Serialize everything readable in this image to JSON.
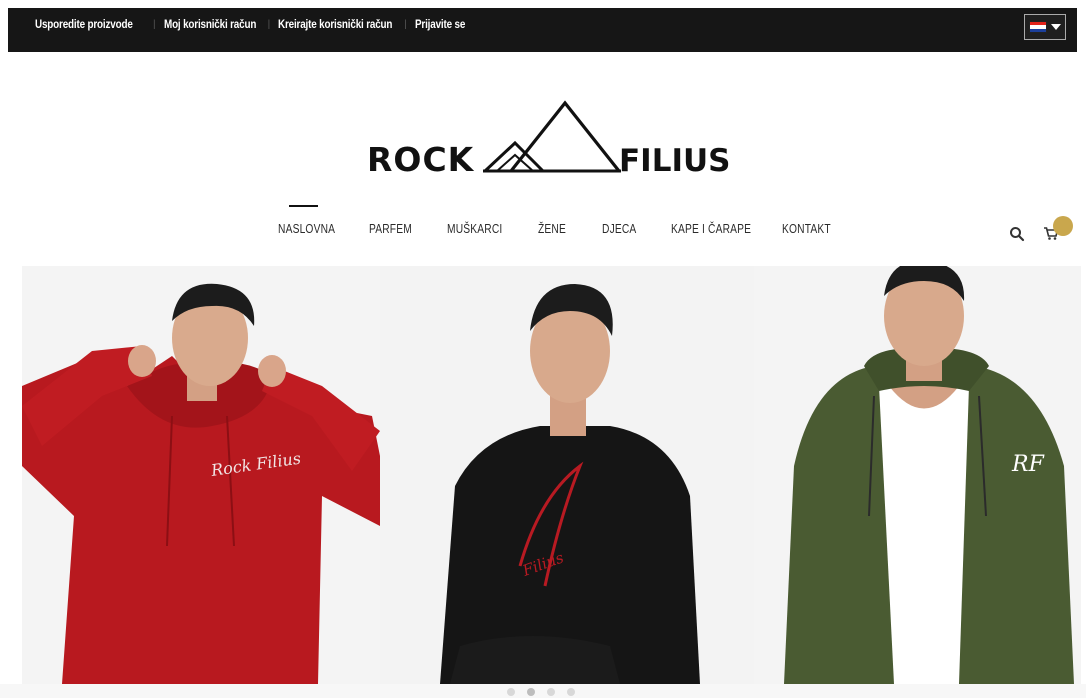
{
  "topbar": {
    "links": [
      {
        "label": "Usporedite proizvode"
      },
      {
        "label": "Moj korisnički račun"
      },
      {
        "label": "Kreirajte korisnički račun"
      },
      {
        "label": "Prijavite se"
      }
    ],
    "language_icon": "croatia-flag-icon"
  },
  "logo": {
    "left_text": "ROCK",
    "right_text": "FILIUS"
  },
  "nav": {
    "items": [
      {
        "label": "NASLOVNA",
        "active": true
      },
      {
        "label": "PARFEM"
      },
      {
        "label": "MUŠKARCI"
      },
      {
        "label": "ŽENE"
      },
      {
        "label": "DJECA"
      },
      {
        "label": "KAPE I ČARAPE"
      },
      {
        "label": "KONTAKT"
      }
    ],
    "search_icon": "search-icon",
    "cart_icon": "cart-icon"
  },
  "slider": {
    "slides": [
      {
        "label": "red-hoodie-model",
        "print": "Rock Filius"
      },
      {
        "label": "black-sweatshirt-model",
        "print": "Filius"
      },
      {
        "label": "green-zip-hoodie-model",
        "print": "RF"
      }
    ],
    "active_dot": 0
  },
  "colors": {
    "topbar": "#161616",
    "accent_badge": "#c9a74d",
    "hoodie_red": "#b8191f",
    "sweatshirt_black": "#151515",
    "hoodie_green": "#4a5b32"
  }
}
